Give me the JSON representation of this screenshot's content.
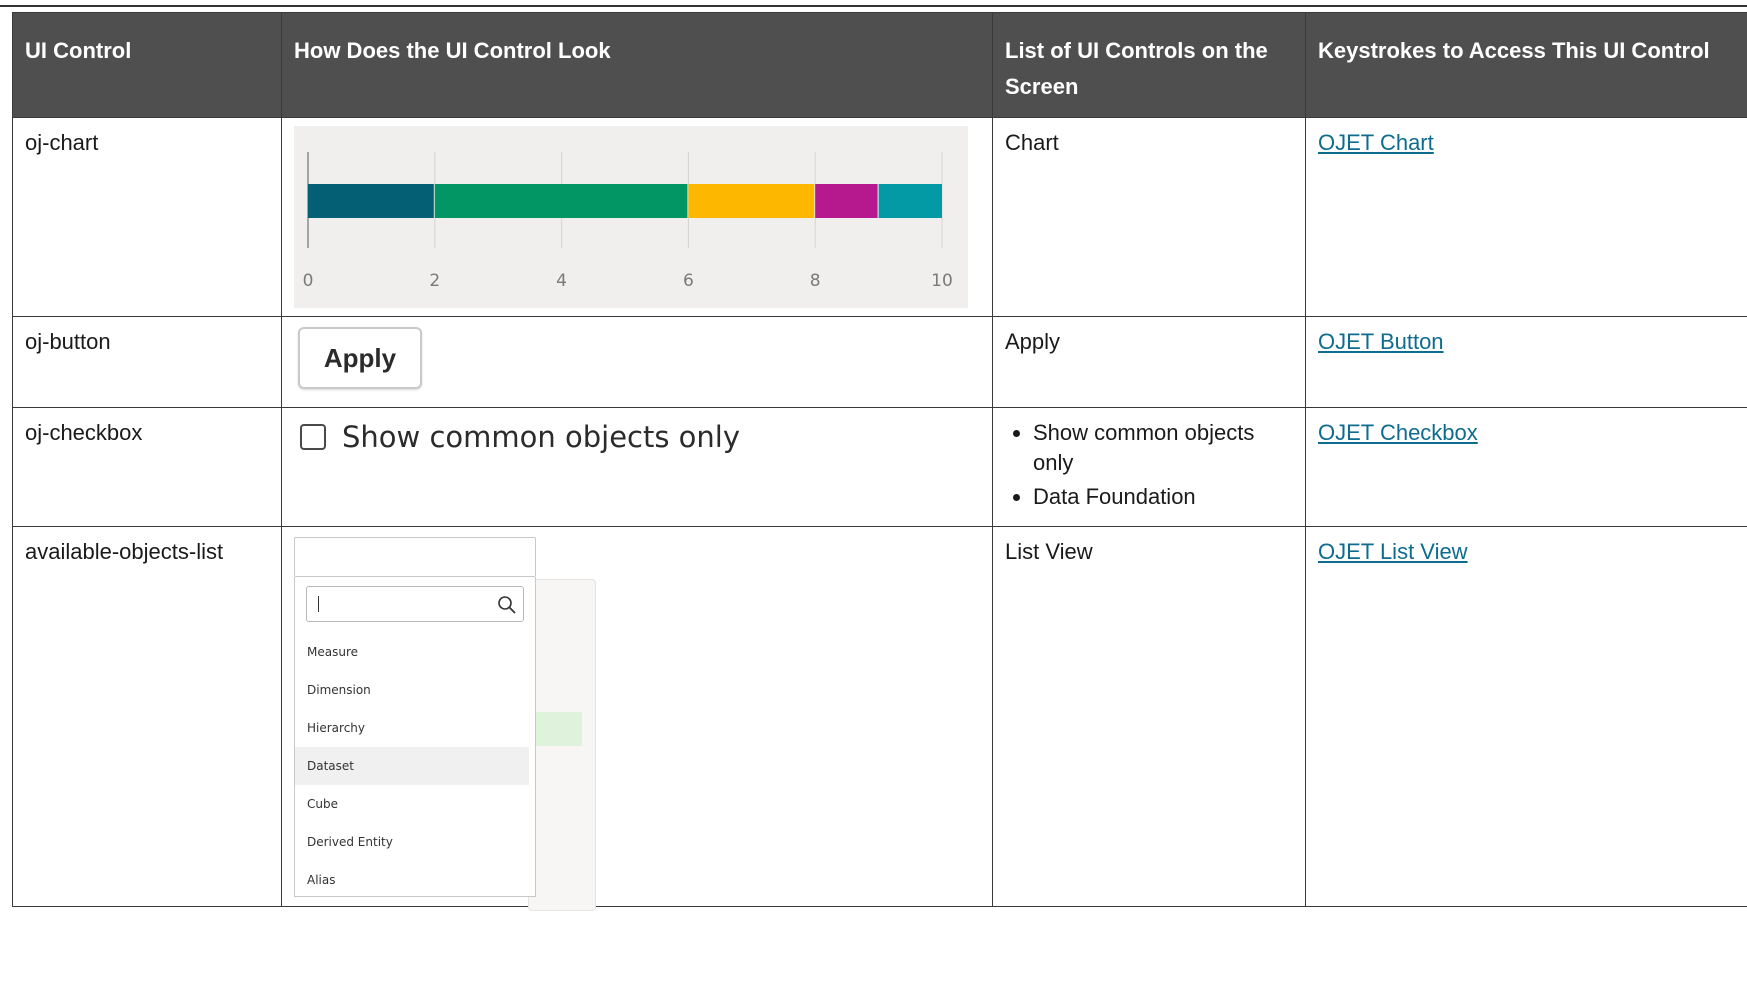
{
  "headers": {
    "col1": "UI Control",
    "col2": "How Does the UI Control Look",
    "col3": "List of UI Controls on the Screen",
    "col4": "Keystrokes to Access This UI Control"
  },
  "rows": [
    {
      "control": "oj-chart",
      "screen_controls": [
        "Chart"
      ],
      "link": "OJET Chart"
    },
    {
      "control": "oj-button",
      "screen_controls": [
        "Apply"
      ],
      "link": "OJET Button"
    },
    {
      "control": "oj-checkbox",
      "screen_controls": [
        "Show common objects only",
        "Data Foundation"
      ],
      "link": "OJET Checkbox"
    },
    {
      "control": "available-objects-list",
      "screen_controls": [
        "List View"
      ],
      "link": "OJET List View"
    }
  ],
  "samples": {
    "apply_label": "Apply",
    "checkbox_label": "Show common objects only",
    "listview": {
      "search_value": "",
      "items": [
        "Measure",
        "Dimension",
        "Hierarchy",
        "Dataset",
        "Cube",
        "Derived Entity",
        "Alias"
      ],
      "selected": "Dataset"
    }
  },
  "chart_data": {
    "type": "bar",
    "orientation": "horizontal",
    "stacked": true,
    "series": [
      {
        "values": [
          2
        ],
        "color": "#045e74"
      },
      {
        "values": [
          4
        ],
        "color": "#039665"
      },
      {
        "values": [
          2
        ],
        "color": "#fdb701"
      },
      {
        "values": [
          1
        ],
        "color": "#b5198d"
      },
      {
        "values": [
          1
        ],
        "color": "#039aa6"
      }
    ],
    "xlim": [
      0,
      10
    ],
    "xticks": [
      "0",
      "2",
      "4",
      "6",
      "8",
      "10"
    ],
    "grid": true,
    "background": "#f1efed"
  }
}
